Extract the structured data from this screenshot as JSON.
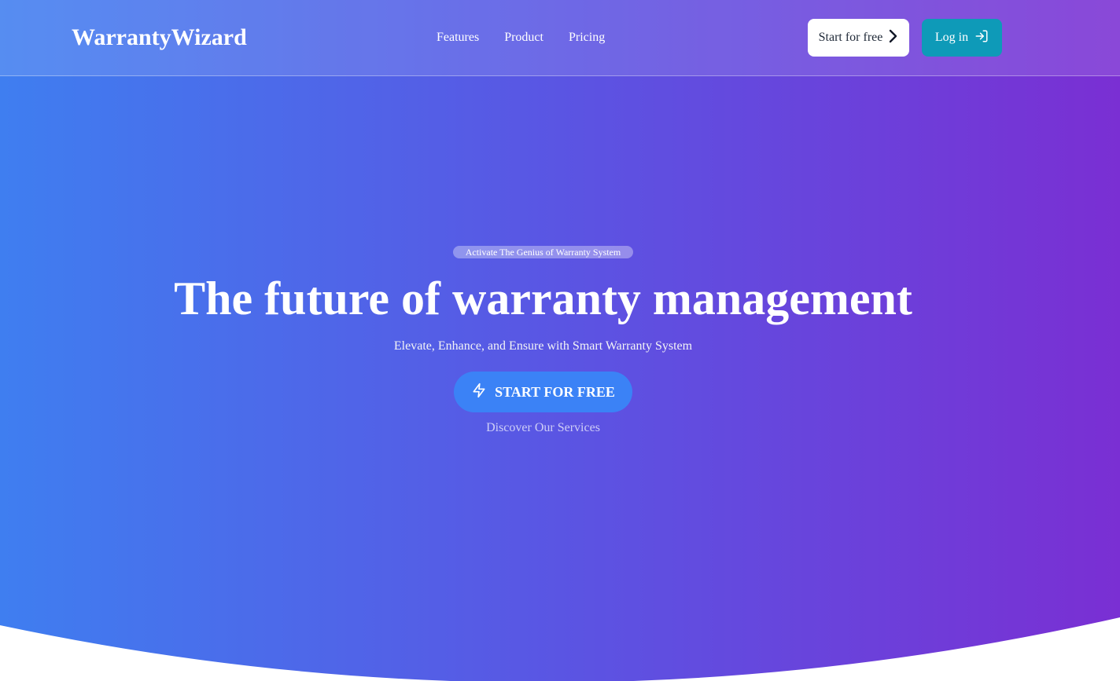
{
  "colors": {
    "gradient_start": "#3f7ef0",
    "gradient_end": "#7a2fd3",
    "login_button": "#0e9ab8",
    "cta_button": "#3b82f6",
    "page_bg": "#ffffff"
  },
  "header": {
    "brand": "WarrantyWizard",
    "nav": [
      {
        "label": "Features"
      },
      {
        "label": "Product"
      },
      {
        "label": "Pricing"
      }
    ],
    "start_button": {
      "label": "Start for free",
      "icon": "chevron-right-icon"
    },
    "login_button": {
      "label": "Log in",
      "icon": "log-in-icon"
    }
  },
  "hero": {
    "badge": "Activate The Genius of Warranty System",
    "headline": "The future of warranty management",
    "subtitle": "Elevate, Enhance, and Ensure with Smart Warranty System",
    "cta": {
      "label": "START FOR FREE",
      "icon": "lightning-icon"
    },
    "secondary_link": "Discover Our Services"
  }
}
